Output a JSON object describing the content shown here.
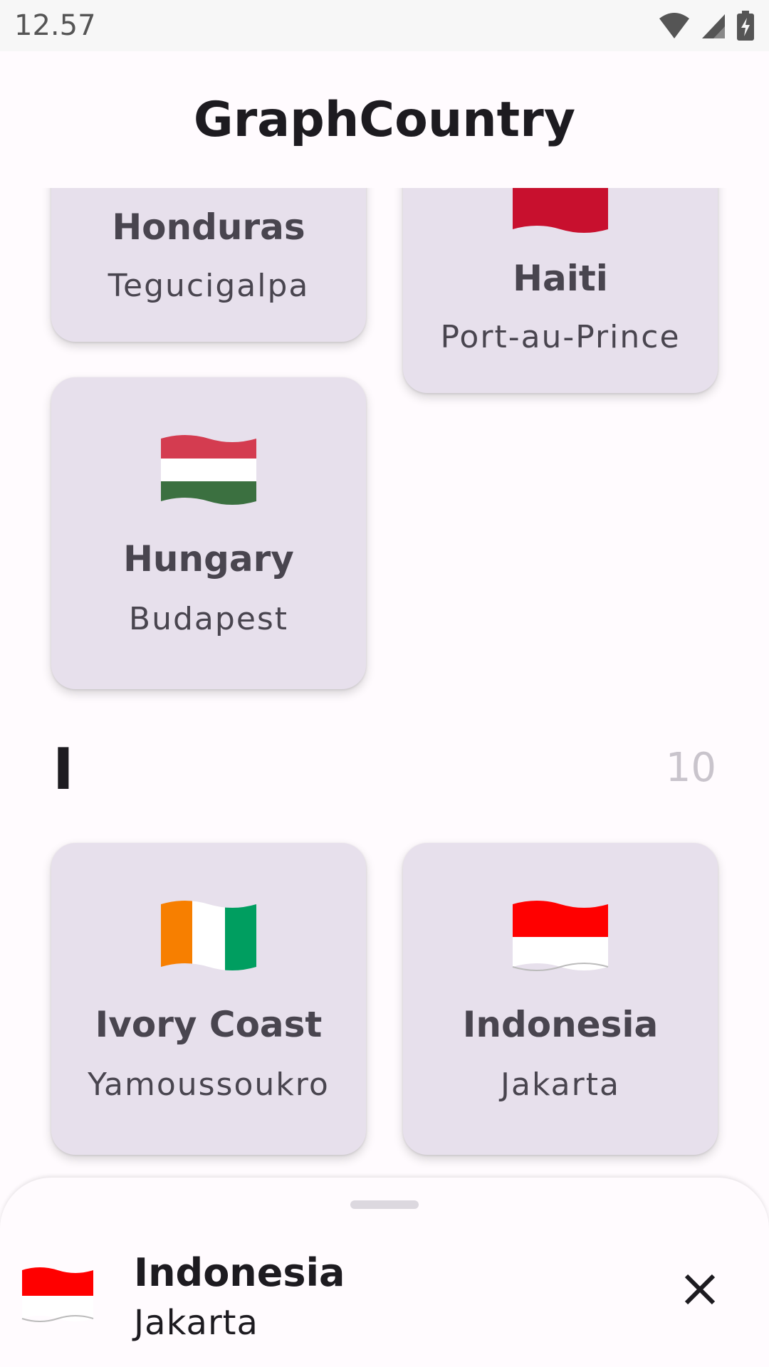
{
  "status_bar": {
    "time": "12.57",
    "icons": [
      "wifi-icon",
      "cell-signal-icon",
      "battery-charging-icon"
    ]
  },
  "app_bar": {
    "title": "GraphCountry"
  },
  "cards": {
    "honduras": {
      "name": "Honduras",
      "capital": "Tegucigalpa"
    },
    "haiti": {
      "name": "Haiti",
      "capital": "Port-au-Prince",
      "flag": "flag-haiti"
    },
    "hungary": {
      "name": "Hungary",
      "capital": "Budapest",
      "flag": "flag-hungary"
    },
    "ivory_coast": {
      "name": "Ivory Coast",
      "capital": "Yamoussoukro",
      "flag": "flag-ivory-coast"
    },
    "indonesia": {
      "name": "Indonesia",
      "capital": "Jakarta",
      "flag": "flag-indonesia"
    }
  },
  "section": {
    "letter": "I",
    "count": "10"
  },
  "bottom_sheet": {
    "name": "Indonesia",
    "capital": "Jakarta",
    "flag": "flag-indonesia",
    "close_icon": "close-icon"
  },
  "colors": {
    "background": "#fffbfe",
    "card": "#e7e0ec",
    "card_text": "#49454f",
    "title_text": "#1d1b20",
    "count_text": "#c9c4cc"
  }
}
